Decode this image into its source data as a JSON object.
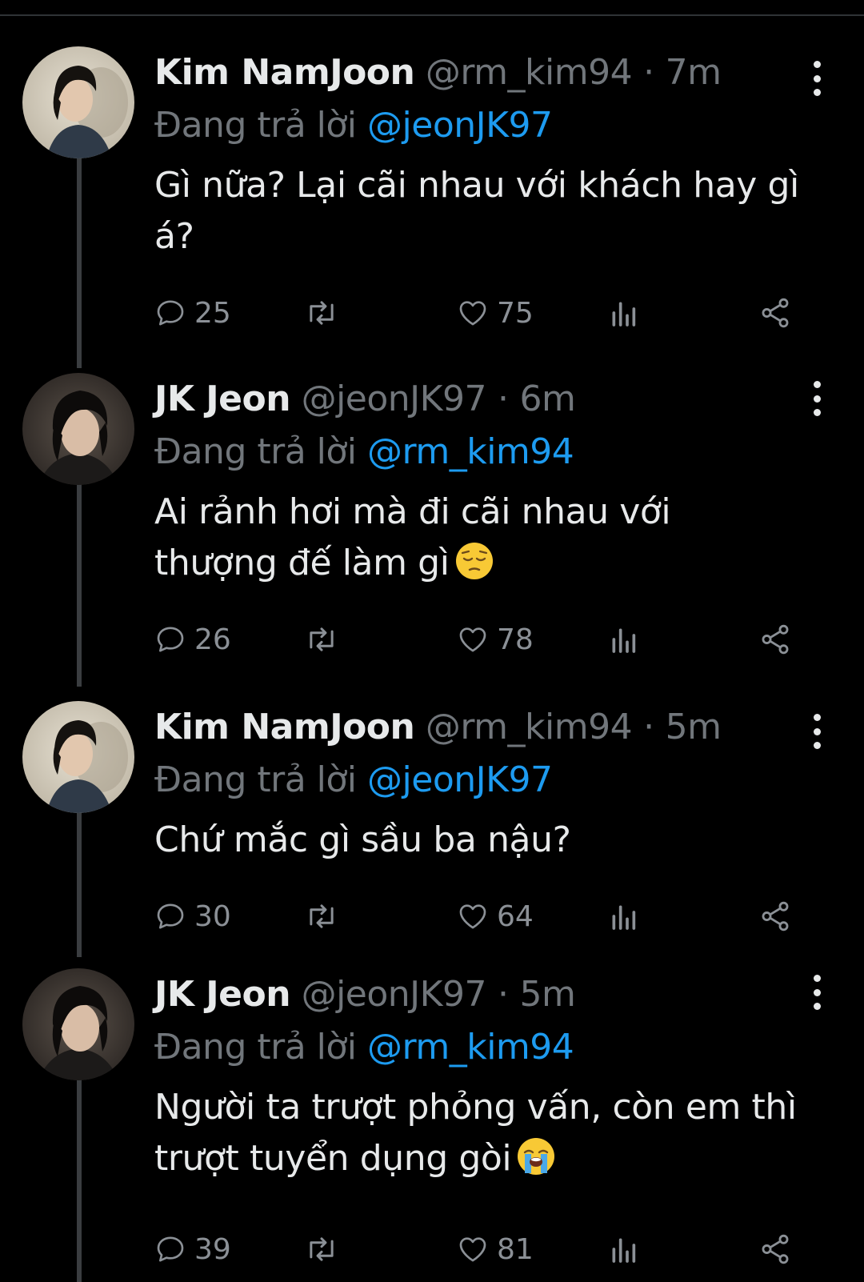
{
  "theme": {
    "background": "#000000",
    "text": "#e7e9ea",
    "muted": "#71767b",
    "link": "#1d9bf0"
  },
  "tweets": [
    {
      "name": "Kim NamJoon",
      "handle": "@rm_kim94",
      "separator": "·",
      "time": "7m",
      "reply_prefix": "Đang trả lời",
      "reply_to": "@jeonJK97",
      "text": "Gì nữa? Lại cãi nhau với khách hay gì á?",
      "emoji": "",
      "replies": "25",
      "likes": "75",
      "avatar_icon": "avatar-rm"
    },
    {
      "name": "JK Jeon",
      "handle": "@jeonJK97",
      "separator": "·",
      "time": "6m",
      "reply_prefix": "Đang trả lời",
      "reply_to": "@rm_kim94",
      "text": "Ai rảnh hơi mà đi cãi nhau với thượng đế làm gì",
      "emoji": "pensive-face",
      "replies": "26",
      "likes": "78",
      "avatar_icon": "avatar-jk"
    },
    {
      "name": "Kim NamJoon",
      "handle": "@rm_kim94",
      "separator": "·",
      "time": "5m",
      "reply_prefix": "Đang trả lời",
      "reply_to": "@jeonJK97",
      "text": "Chứ mắc gì sầu ba nậu?",
      "emoji": "",
      "replies": "30",
      "likes": "64",
      "avatar_icon": "avatar-rm"
    },
    {
      "name": "JK Jeon",
      "handle": "@jeonJK97",
      "separator": "·",
      "time": "5m",
      "reply_prefix": "Đang trả lời",
      "reply_to": "@rm_kim94",
      "text": "Người ta trượt phỏng vấn, còn em thì trượt tuyển dụng gòi",
      "emoji": "loudly-crying-face",
      "replies": "39",
      "likes": "81",
      "avatar_icon": "avatar-jk"
    }
  ]
}
